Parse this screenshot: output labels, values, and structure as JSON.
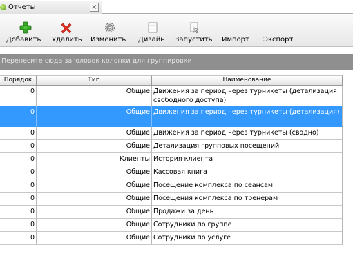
{
  "tab": {
    "title": "Отчеты",
    "close_glyph": "×",
    "icon": "report-icon",
    "close_icon": "close-icon"
  },
  "toolbar": {
    "buttons": [
      {
        "label": "Добавить",
        "icon": "plus-icon"
      },
      {
        "label": "Удалить",
        "icon": "delete-x-icon"
      },
      {
        "label": "Изменить",
        "icon": "gear-icon"
      },
      {
        "label": "Дизайн",
        "icon": "design-icon"
      },
      {
        "label": "Запустить",
        "icon": "run-icon"
      },
      {
        "label": "Импорт",
        "icon": ""
      },
      {
        "label": "Экспорт",
        "icon": ""
      }
    ]
  },
  "groupbar": {
    "text": "Перенесите сюда заголовок колонки для группировки"
  },
  "grid": {
    "columns": [
      "Порядок",
      "Тип",
      "Наименование"
    ],
    "rows": [
      {
        "order": "0",
        "type": "Общие",
        "name": "Движения за период через турникеты (детализация свободного доступа)",
        "selected": false
      },
      {
        "order": "0",
        "type": "Общие",
        "name": "Движения за период через турникеты (детализация)",
        "selected": true
      },
      {
        "order": "0",
        "type": "Общие",
        "name": "Движения за период через турникеты (сводно)",
        "selected": false
      },
      {
        "order": "0",
        "type": "Общие",
        "name": "Детализация групповых посещений",
        "selected": false
      },
      {
        "order": "0",
        "type": "Клиенты",
        "name": "История клиента",
        "selected": false
      },
      {
        "order": "0",
        "type": "Общие",
        "name": "Кассовая книга",
        "selected": false
      },
      {
        "order": "0",
        "type": "Общие",
        "name": "Посещение комплекса по сеансам",
        "selected": false
      },
      {
        "order": "0",
        "type": "Общие",
        "name": "Посещения комплекса по тренерам",
        "selected": false
      },
      {
        "order": "0",
        "type": "Общие",
        "name": "Продажи за день",
        "selected": false
      },
      {
        "order": "0",
        "type": "Общие",
        "name": "Сотрудники по группе",
        "selected": false
      },
      {
        "order": "0",
        "type": "Общие",
        "name": "Сотрудники по услуге",
        "selected": false
      }
    ]
  }
}
